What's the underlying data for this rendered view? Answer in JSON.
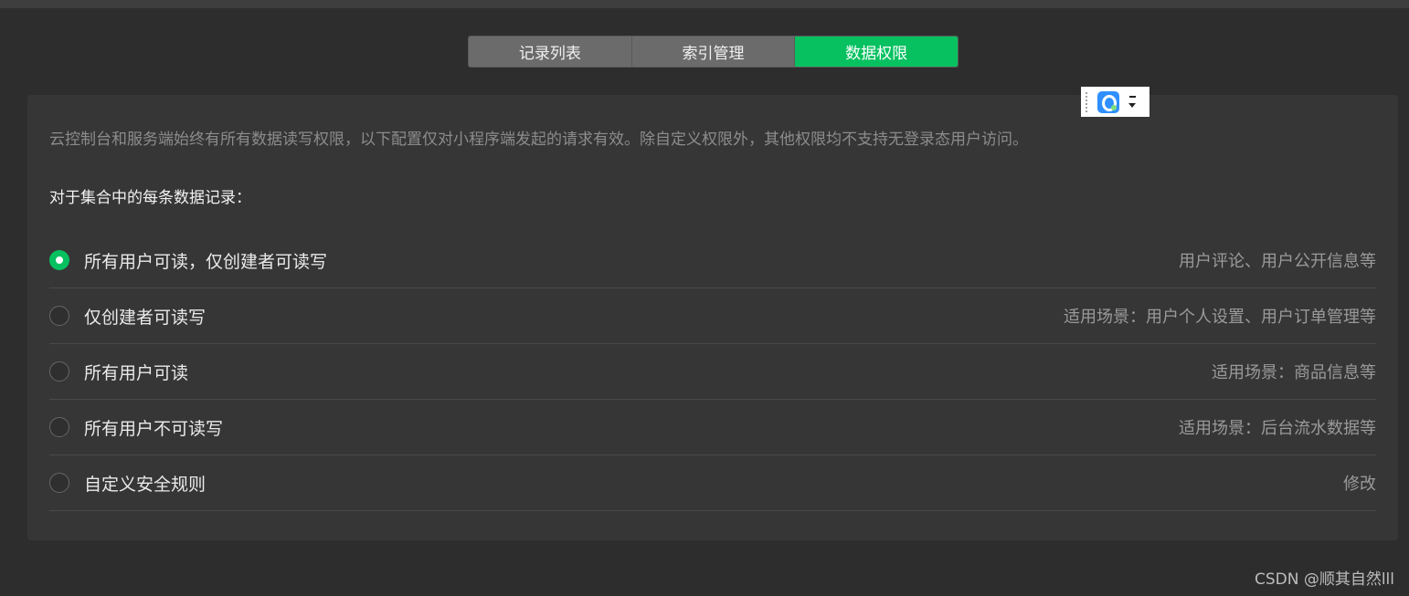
{
  "tabs": [
    {
      "label": "记录列表",
      "active": false
    },
    {
      "label": "索引管理",
      "active": false
    },
    {
      "label": "数据权限",
      "active": true
    }
  ],
  "panel": {
    "description": "云控制台和服务端始终有所有数据读写权限，以下配置仅对小程序端发起的请求有效。除自定义权限外，其他权限均不支持无登录态用户访问。",
    "section_title": "对于集合中的每条数据记录：",
    "options": [
      {
        "label": "所有用户可读，仅创建者可读写",
        "hint": "用户评论、用户公开信息等",
        "checked": true
      },
      {
        "label": "仅创建者可读写",
        "hint": "适用场景：用户个人设置、用户订单管理等",
        "checked": false
      },
      {
        "label": "所有用户可读",
        "hint": "适用场景：商品信息等",
        "checked": false
      },
      {
        "label": "所有用户不可读写",
        "hint": "适用场景：后台流水数据等",
        "checked": false
      },
      {
        "label": "自定义安全规则",
        "hint": "修改",
        "checked": false
      }
    ]
  },
  "watermark": "CSDN @顺其自然lll",
  "colors": {
    "accent": "#07c160",
    "background": "#2d2d2d",
    "panel": "#363636"
  },
  "icons": {
    "widget": "floating-toolbar-q-icon",
    "radio_checked": "radio-checked-icon",
    "radio_unchecked": "radio-unchecked-icon"
  }
}
